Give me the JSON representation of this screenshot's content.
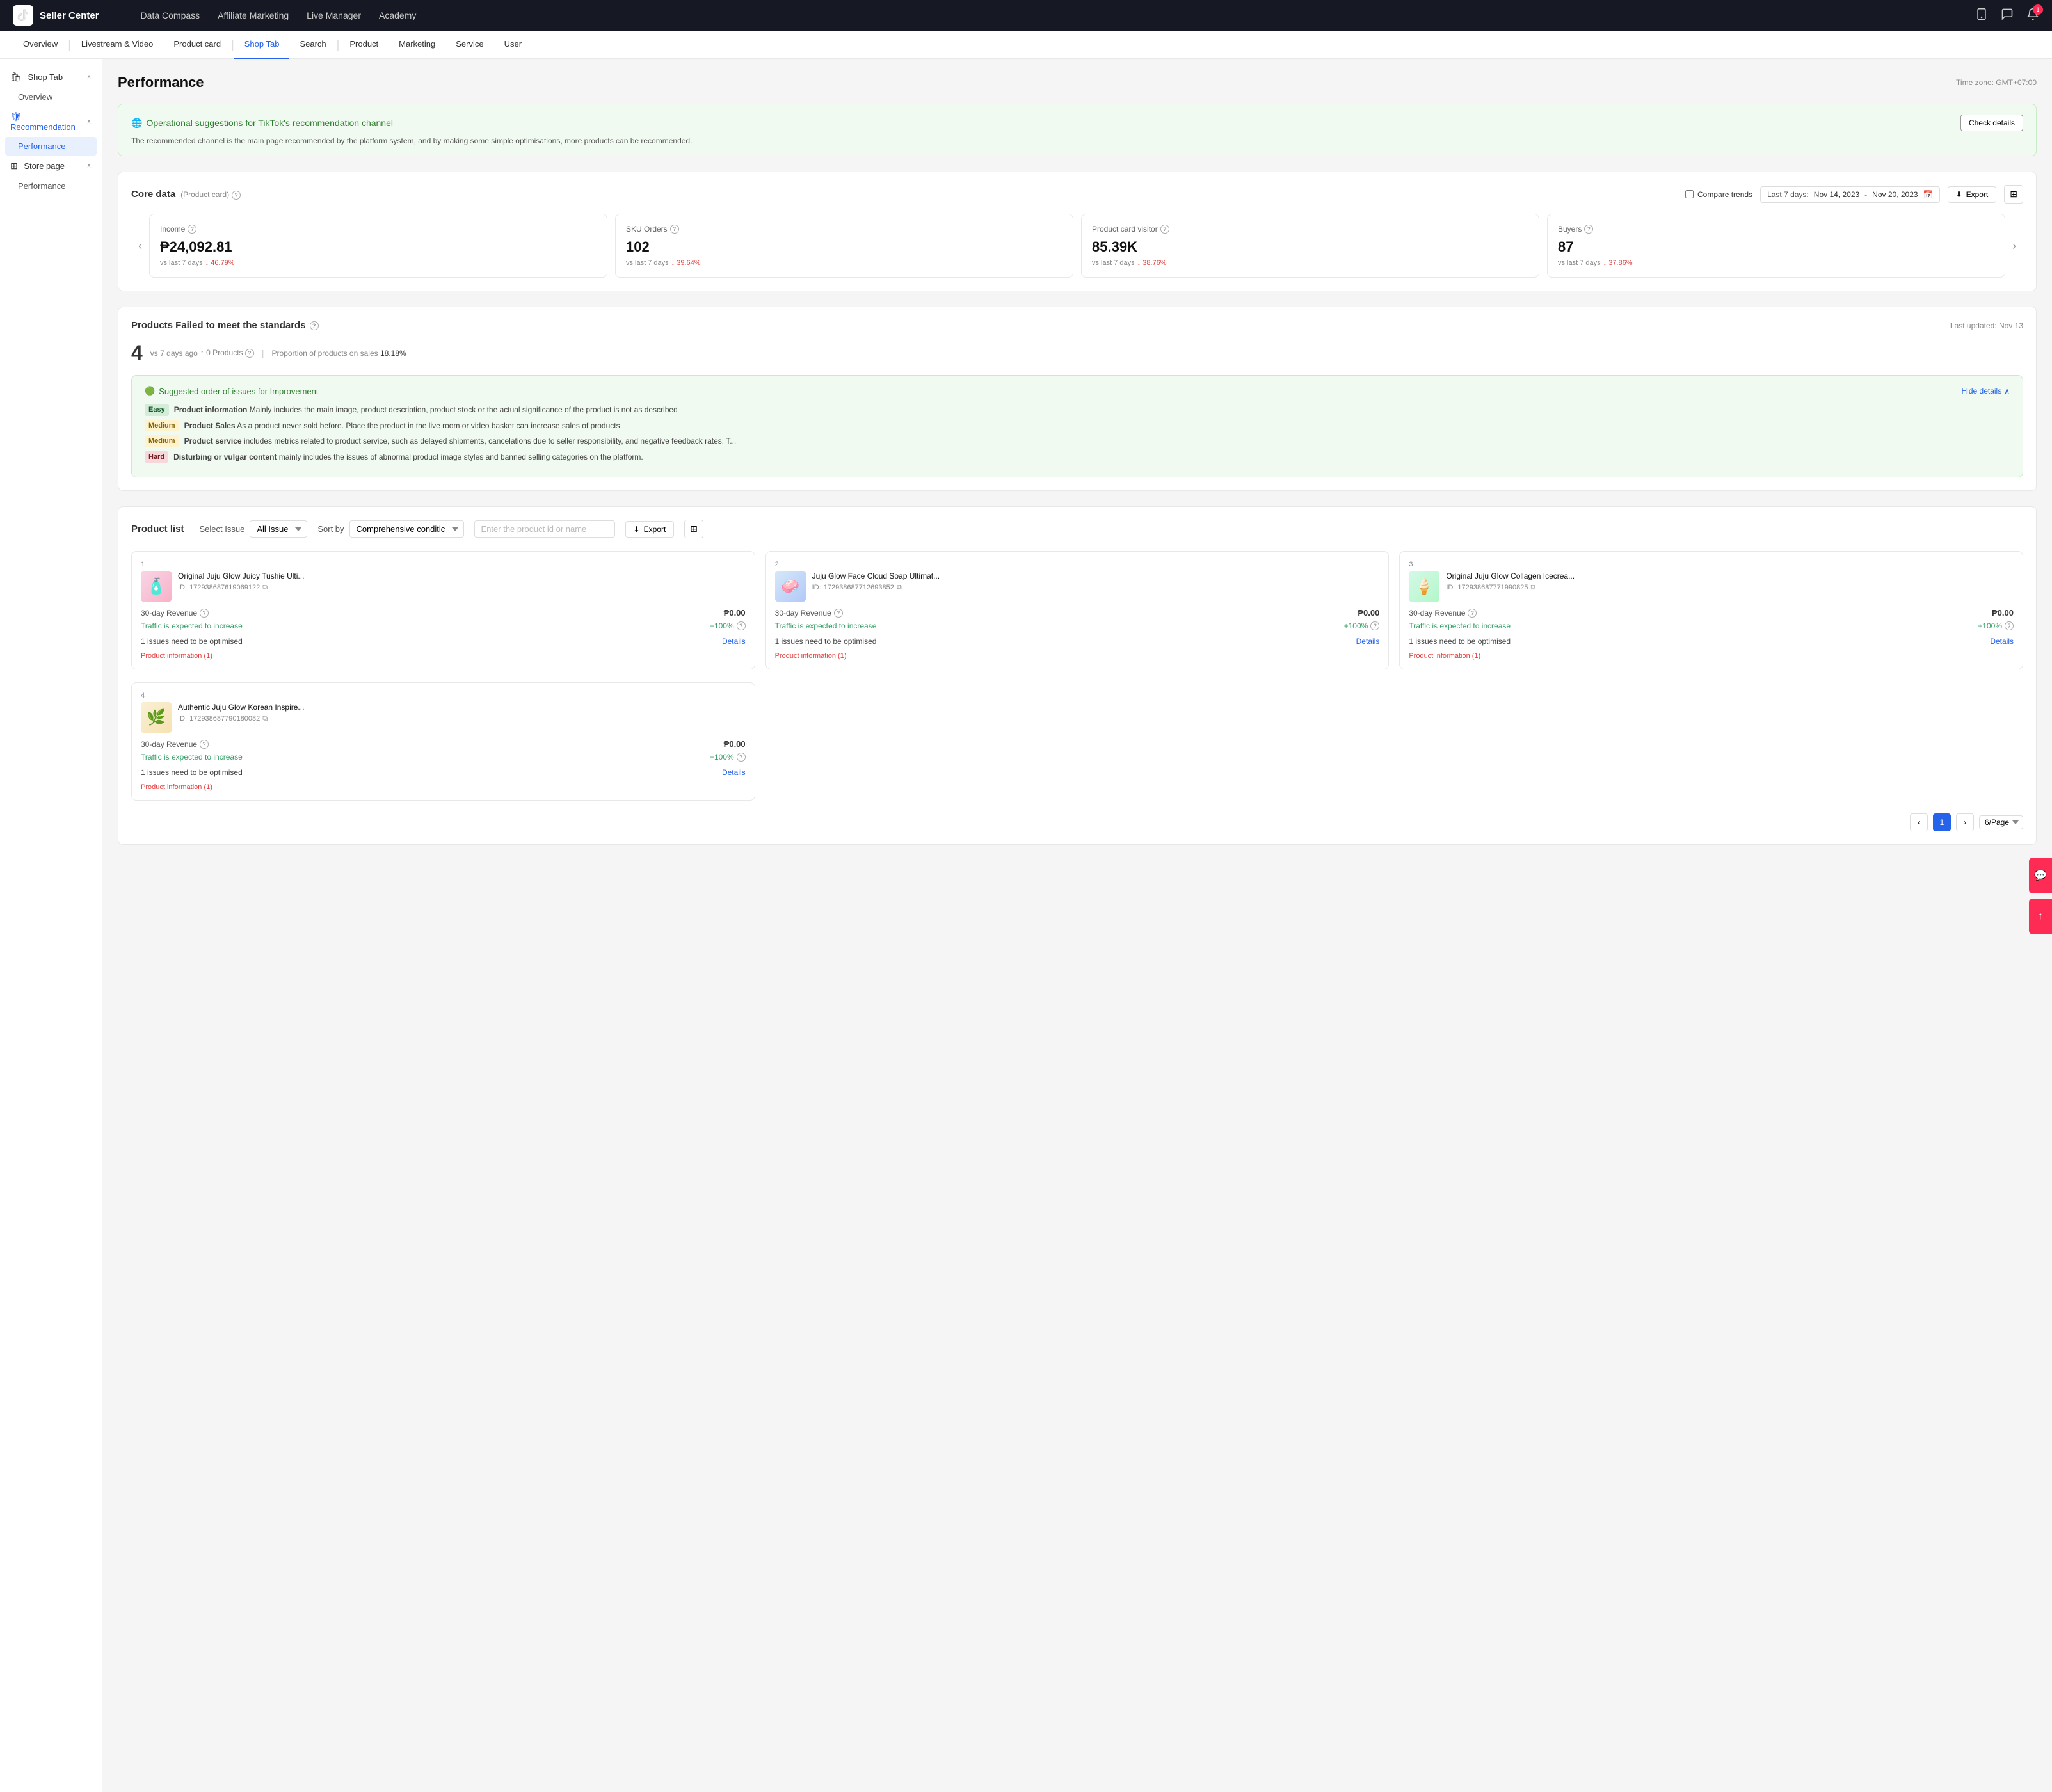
{
  "topnav": {
    "brand": "Seller Center",
    "links": [
      "Data Compass",
      "Affiliate Marketing",
      "Live Manager",
      "Academy"
    ],
    "icons": [
      "mobile-icon",
      "chat-icon",
      "notification-icon"
    ],
    "notification_count": "1"
  },
  "secondnav": {
    "items": [
      {
        "label": "Overview",
        "active": false
      },
      {
        "label": "Livestream & Video",
        "active": false
      },
      {
        "label": "Product card",
        "active": false
      },
      {
        "label": "Shop Tab",
        "active": true
      },
      {
        "label": "Search",
        "active": false
      },
      {
        "label": "Product",
        "active": false
      },
      {
        "label": "Marketing",
        "active": false
      },
      {
        "label": "Service",
        "active": false
      },
      {
        "label": "User",
        "active": false
      }
    ]
  },
  "sidebar": {
    "sections": [
      {
        "label": "Shop Tab",
        "icon": "shop-icon",
        "expanded": true,
        "items": [
          {
            "label": "Overview",
            "active": false
          }
        ]
      },
      {
        "label": "Recommendation",
        "icon": "shield-icon",
        "expanded": true,
        "items": [
          {
            "label": "Performance",
            "active": true
          }
        ]
      },
      {
        "label": "Store page",
        "icon": "table-icon",
        "expanded": true,
        "items": [
          {
            "label": "Performance",
            "active": false
          }
        ]
      }
    ]
  },
  "page": {
    "title": "Performance",
    "timezone": "Time zone: GMT+07:00"
  },
  "suggestion": {
    "title": "Operational suggestions for TikTok's recommendation channel",
    "description": "The recommended channel is the main page recommended by the platform system, and by making some simple optimisations, more products can be recommended.",
    "button_label": "Check details",
    "icon": "globe-icon"
  },
  "core_data": {
    "title": "Core data",
    "subtitle": "(Product card)",
    "compare_label": "Compare trends",
    "date_range": "Last 7 days: Nov 14, 2023 - Nov 20, 2023",
    "date_start": "Nov 14, 2023",
    "date_end": "Nov 20, 2023",
    "export_label": "Export",
    "metrics": [
      {
        "label": "Income",
        "value": "₱24,092.81",
        "compare": "vs last 7 days",
        "change": "↓ 46.79%",
        "change_type": "red"
      },
      {
        "label": "SKU Orders",
        "value": "102",
        "compare": "vs last 7 days",
        "change": "↓ 39.64%",
        "change_type": "red"
      },
      {
        "label": "Product card visitor",
        "value": "85.39K",
        "compare": "vs last 7 days",
        "change": "↓ 38.76%",
        "change_type": "red"
      },
      {
        "label": "Buyers",
        "value": "87",
        "compare": "vs last 7 days",
        "change": "↓ 37.86%",
        "change_type": "red"
      }
    ]
  },
  "products_failed": {
    "title": "Products Failed to meet the standards",
    "last_updated": "Last updated: Nov 13",
    "count": "4",
    "count_meta": "vs 7 days ago",
    "zero_products": "↑ 0 Products",
    "proportion_label": "Proportion of products on sales",
    "proportion_value": "18.18%",
    "suggested_order": {
      "title": "Suggested order of issues for Improvement",
      "hide_label": "Hide details",
      "issues": [
        {
          "tag": "Easy",
          "tag_class": "tag-easy",
          "title": "Product information",
          "desc": "Mainly includes the main image, product description, product stock or the actual significance of the product is not as described"
        },
        {
          "tag": "Medium",
          "tag_class": "tag-medium",
          "title": "Product Sales",
          "desc": "As a product never sold before. Place the product in the live room or video basket can increase sales of products"
        },
        {
          "tag": "Medium",
          "tag_class": "tag-medium",
          "title": "Product service",
          "desc": "includes metrics related to product service, such as delayed shipments, cancelations due to seller responsibility, and negative feedback rates. T..."
        },
        {
          "tag": "Hard",
          "tag_class": "tag-hard",
          "title": "Disturbing or vulgar content",
          "desc": "mainly includes the issues of abnormal product image styles and banned selling categories on the platform."
        }
      ]
    }
  },
  "product_list": {
    "title": "Product list",
    "select_issue_label": "Select Issue",
    "sort_by_label": "Sort by",
    "select_issue_value": "All Issue",
    "sort_by_value": "Comprehensive conditic",
    "search_placeholder": "Enter the product id or name",
    "export_label": "Export",
    "products": [
      {
        "num": "1",
        "name": "Original Juju Glow Juicy Tushie Ulti...",
        "id": "172938687619069122",
        "revenue_label": "30-day Revenue",
        "revenue": "₱0.00",
        "traffic_label": "Traffic is expected to increase",
        "traffic_change": "+100%",
        "issues_label": "1 issues need to be optimised",
        "details_label": "Details",
        "info_tag": "Product information (1)",
        "thumb_class": "product-thumb-1"
      },
      {
        "num": "2",
        "name": "Juju Glow Face Cloud Soap Ultimat...",
        "id": "172938687712693852",
        "revenue_label": "30-day Revenue",
        "revenue": "₱0.00",
        "traffic_label": "Traffic is expected to increase",
        "traffic_change": "+100%",
        "issues_label": "1 issues need to be optimised",
        "details_label": "Details",
        "info_tag": "Product information (1)",
        "thumb_class": "product-thumb-2"
      },
      {
        "num": "3",
        "name": "Original Juju Glow Collagen Icecrea...",
        "id": "172938687771990825",
        "revenue_label": "30-day Revenue",
        "revenue": "₱0.00",
        "traffic_label": "Traffic is expected to increase",
        "traffic_change": "+100%",
        "issues_label": "1 issues need to be optimised",
        "details_label": "Details",
        "info_tag": "Product information (1)",
        "thumb_class": "product-thumb-3"
      },
      {
        "num": "4",
        "name": "Authentic Juju Glow Korean Inspire...",
        "id": "172938687790180082",
        "revenue_label": "30-day Revenue",
        "revenue": "₱0.00",
        "traffic_label": "Traffic is expected to increase",
        "traffic_change": "+100%",
        "issues_label": "1 issues need to be optimised",
        "details_label": "Details",
        "info_tag": "Product information (1)",
        "thumb_class": "product-thumb-4"
      }
    ],
    "pagination": {
      "current_page": "1",
      "per_page": "6/Page"
    }
  }
}
